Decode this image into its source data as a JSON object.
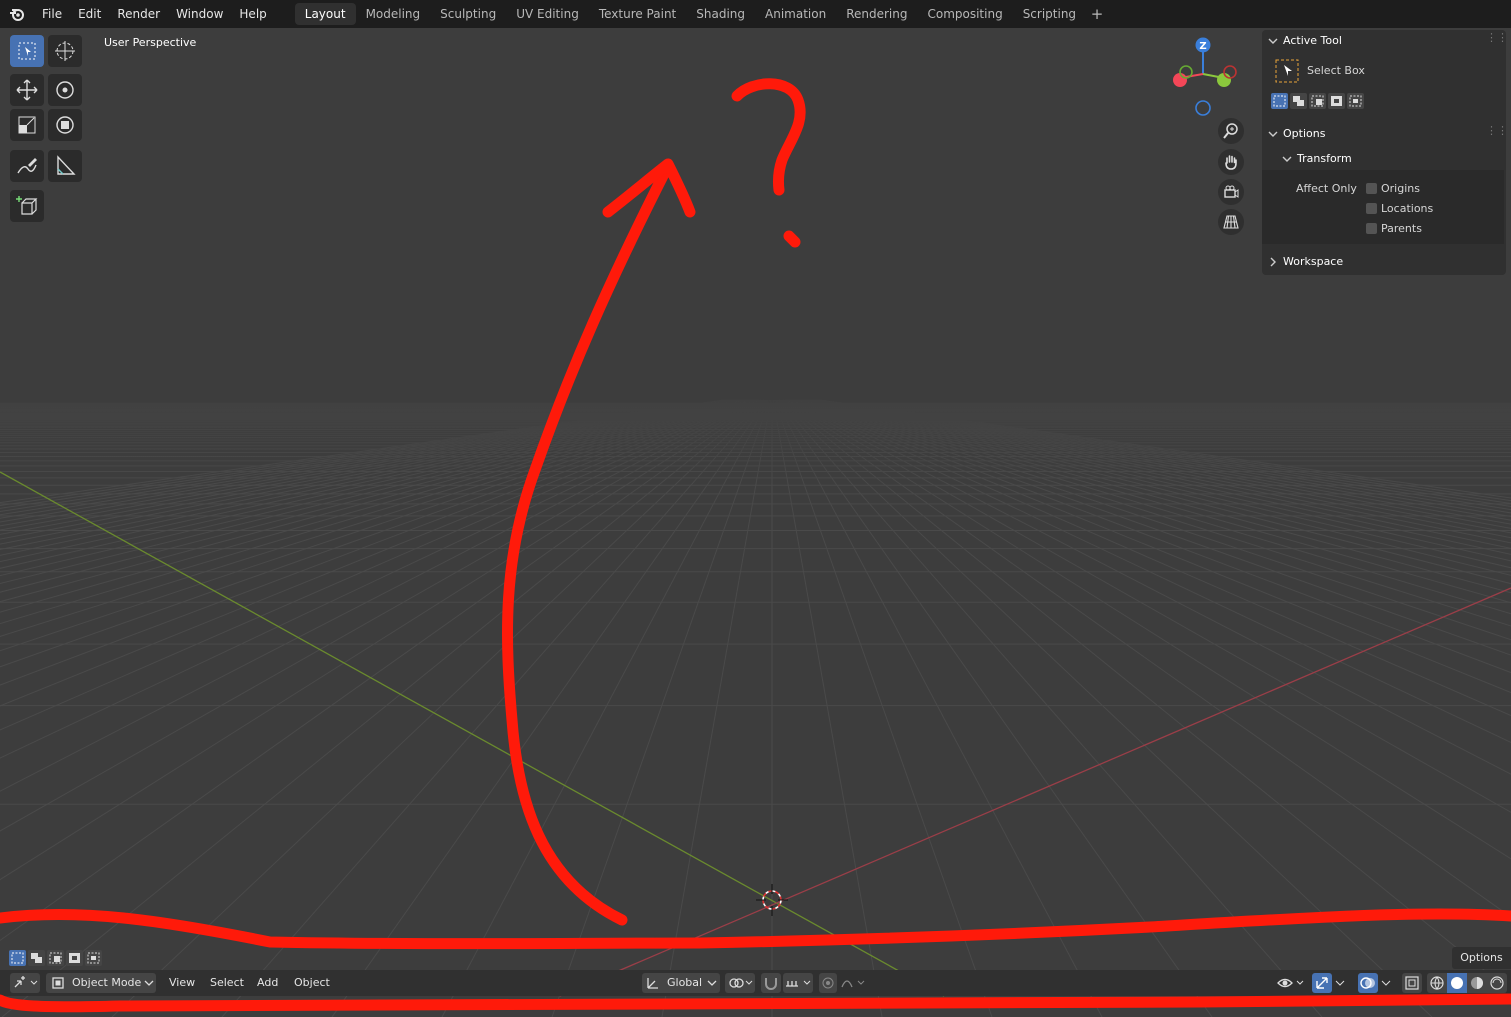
{
  "menu": {
    "items": [
      "File",
      "Edit",
      "Render",
      "Window",
      "Help"
    ]
  },
  "workspaces": {
    "tabs": [
      "Layout",
      "Modeling",
      "Sculpting",
      "UV Editing",
      "Texture Paint",
      "Shading",
      "Animation",
      "Rendering",
      "Compositing",
      "Scripting"
    ],
    "active": "Layout",
    "add_label": "+"
  },
  "viewport": {
    "view_label": "User Perspective"
  },
  "gizmo": {
    "z_label": "Z",
    "colors": {
      "x": "#f44758",
      "y": "#8bc83d",
      "z": "#3a7fdb"
    }
  },
  "right_panel": {
    "active_tool_header": "Active Tool",
    "tool_name": "Select Box",
    "options_header": "Options",
    "transform_header": "Transform",
    "affect_only_label": "Affect Only",
    "checkboxes": [
      {
        "label": "Origins",
        "checked": false
      },
      {
        "label": "Locations",
        "checked": false
      },
      {
        "label": "Parents",
        "checked": false
      }
    ],
    "workspace_header": "Workspace"
  },
  "bottom_bar": {
    "mode": "Object Mode",
    "menus": [
      "View",
      "Select",
      "Add",
      "Object"
    ],
    "orientation": "Global",
    "options_label": "Options"
  },
  "annotation": {
    "color": "#ff1a0a",
    "question_mark": "?"
  }
}
